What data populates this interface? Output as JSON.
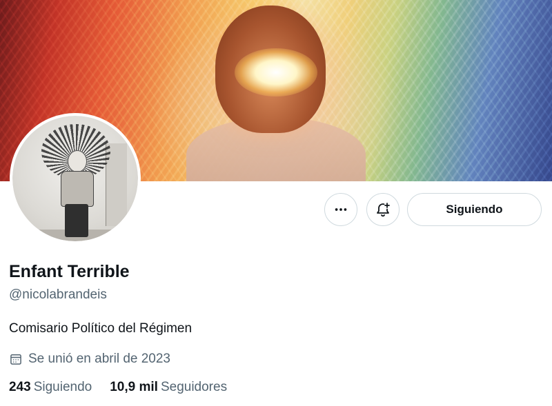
{
  "profile": {
    "name": "Enfant Terrible",
    "handle": "@nicolabrandeis",
    "bio": "Comisario Político del Régimen",
    "joined": "Se unió en abril de 2023"
  },
  "actions": {
    "more_icon": "more-horizontal-icon",
    "notify_icon": "bell-plus-icon",
    "follow_label": "Siguiendo"
  },
  "stats": {
    "following_count": "243",
    "following_label": "Siguiendo",
    "followers_count": "10,9 mil",
    "followers_label": "Seguidores"
  },
  "colors": {
    "primary_text": "#0f1419",
    "secondary_text": "#536471",
    "button_border": "#cfd9de"
  }
}
